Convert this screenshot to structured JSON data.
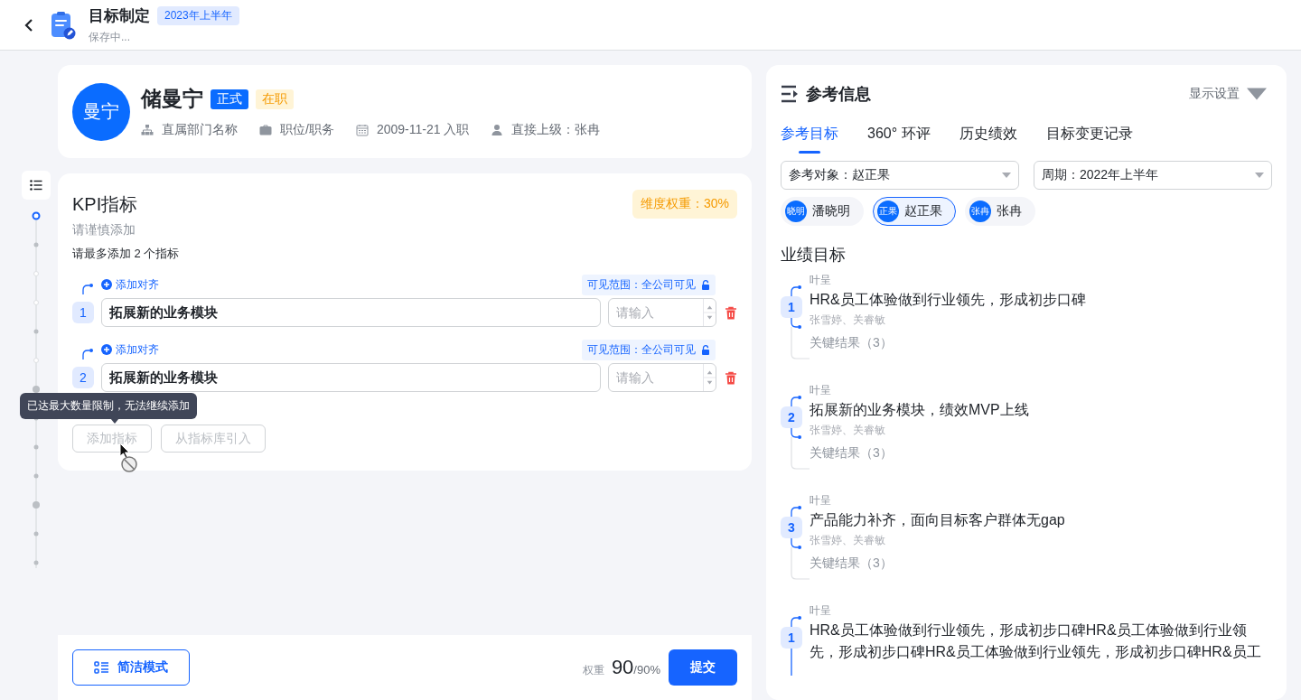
{
  "header": {
    "title": "目标制定",
    "period_badge": "2023年上半年",
    "status": "保存中..."
  },
  "profile": {
    "avatar_text": "曼宁",
    "name": "储曼宁",
    "tags": [
      {
        "label": "正式",
        "kind": "employment"
      },
      {
        "label": "在职",
        "kind": "status"
      }
    ],
    "meta": [
      {
        "kind": "department",
        "text": "直属部门名称"
      },
      {
        "kind": "position",
        "text": "职位/职务"
      },
      {
        "kind": "date",
        "text": "2009-11-21 入职"
      },
      {
        "kind": "manager",
        "text": "直接上级：张冉"
      }
    ]
  },
  "kpi": {
    "title": "KPI指标",
    "weight_badge": "维度权重：30%",
    "hint": "请谨慎添加",
    "limit_note": "请最多添加 2 个指标",
    "items": [
      {
        "number": "1",
        "align_label": "添加对齐",
        "visibility": "可见范围：全公司可见",
        "value": "拓展新的业务模块",
        "weight_placeholder": "请输入"
      },
      {
        "number": "2",
        "align_label": "添加对齐",
        "visibility": "可见范围：全公司可见",
        "value": "拓展新的业务模块",
        "weight_placeholder": "请输入"
      }
    ],
    "tooltip": "已达最大数量限制，无法继续添加",
    "buttons": [
      {
        "label": "添加指标",
        "disabled": true
      },
      {
        "label": "从指标库引入",
        "disabled": true
      }
    ]
  },
  "footer": {
    "mode_button": "简洁模式",
    "weight_label": "权重",
    "weight_value": "90",
    "weight_total": "/90%",
    "submit": "提交"
  },
  "reference": {
    "title": "参考信息",
    "settings": "显示设置",
    "tabs": [
      {
        "label": "参考目标",
        "selected": true
      },
      {
        "label": "360° 环评",
        "selected": false
      },
      {
        "label": "历史绩效",
        "selected": false
      },
      {
        "label": "目标变更记录",
        "selected": false
      }
    ],
    "filters": [
      {
        "text": "参考对象：赵正果"
      },
      {
        "text": "周期：2022年上半年"
      }
    ],
    "people": [
      {
        "avatar_text": "晓明",
        "name": "潘晓明",
        "selected": false
      },
      {
        "avatar_text": "正果",
        "name": "赵正果",
        "selected": true
      },
      {
        "avatar_text": "张冉",
        "name": "张冉",
        "selected": false
      }
    ],
    "section_title": "业绩目标",
    "goals": [
      {
        "owner": "叶呈",
        "number": "1",
        "title": "HR&员工体验做到行业领先，形成初步口碑",
        "participants": "张雪婷、关睿敏",
        "key_results": "关键结果（3）"
      },
      {
        "owner": "叶呈",
        "number": "2",
        "title": "拓展新的业务模块，绩效MVP上线",
        "participants": "张雪婷、关睿敏",
        "key_results": "关键结果（3）"
      },
      {
        "owner": "叶呈",
        "number": "3",
        "title": "产品能力补齐，面向目标客户群体无gap",
        "participants": "张雪婷、关睿敏",
        "key_results": "关键结果（3）"
      },
      {
        "owner": "叶呈",
        "number": "1",
        "title": "HR&员工体验做到行业领先，形成初步口碑HR&员工体验做到行业领先，形成初步口碑HR&员工体验做到行业领先，形成初步口碑HR&员工"
      }
    ]
  }
}
